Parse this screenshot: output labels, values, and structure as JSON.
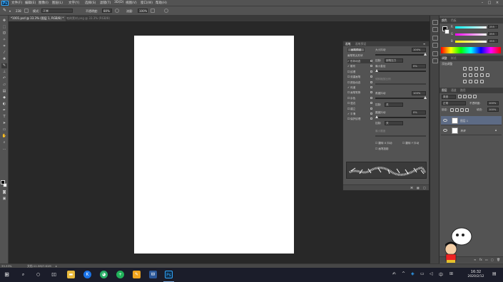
{
  "app": {
    "logo": "Ps"
  },
  "menu": [
    "文件(F)",
    "编辑(E)",
    "图像(I)",
    "图层(L)",
    "文字(Y)",
    "选择(S)",
    "滤镜(T)",
    "3D(D)",
    "视图(V)",
    "窗口(W)",
    "帮助(H)"
  ],
  "options": {
    "brush_size": "238",
    "mode_label": "模式:",
    "mode_value": "正常",
    "opacity_label": "不透明度:",
    "opacity_value": "80%",
    "flow_label": "流量:",
    "flow_value": "100%"
  },
  "tabs": [
    {
      "label": "*1001.psd @ 33.3% (图层 1, RGB/8) *",
      "active": true
    },
    {
      "label": "笔刷素材.png @ 33.3% (RGB/8)",
      "active": false
    }
  ],
  "brush_panel": {
    "tabs": [
      "画笔",
      "画笔预设"
    ],
    "preset_button": "画笔预设",
    "tip_shape_title": "画笔笔尖形状",
    "items": [
      {
        "label": "形状动态",
        "checked": true
      },
      {
        "label": "散布",
        "checked": true
      },
      {
        "label": "纹理",
        "checked": false
      },
      {
        "label": "双重画笔",
        "checked": false
      },
      {
        "label": "颜色动态",
        "checked": false
      },
      {
        "label": "传递",
        "checked": true
      },
      {
        "label": "画笔笔势",
        "checked": false
      },
      {
        "label": "杂色",
        "checked": false
      },
      {
        "label": "湿边",
        "checked": false
      },
      {
        "label": "建立",
        "checked": false
      },
      {
        "label": "平滑",
        "checked": true
      },
      {
        "label": "保护纹理",
        "checked": false
      }
    ],
    "size_jitter_label": "大小抖动",
    "size_jitter_value": "100%",
    "control_label": "控制:",
    "control_value": "钢笔压力",
    "min_diameter_label": "最小直径",
    "min_diameter_value": "0%",
    "tilt_scale_label": "倾斜缩放比例",
    "angle_jitter_label": "角度抖动",
    "angle_jitter_value": "100%",
    "control2_value": "关",
    "roundness_jitter_label": "圆度抖动",
    "roundness_jitter_value": "0%",
    "control3_value": "关",
    "min_roundness_label": "最小圆度",
    "flip_x_label": "翻转 X 抖动",
    "flip_y_label": "翻转 Y 抖动",
    "projection_label": "画笔投影"
  },
  "color_panel": {
    "tabs": [
      "颜色",
      "色板"
    ],
    "channels": [
      {
        "label": "R",
        "value": "255"
      },
      {
        "label": "G",
        "value": "255"
      },
      {
        "label": "B",
        "value": "255"
      }
    ]
  },
  "adjust_panel": {
    "tabs": [
      "调整",
      "样式"
    ],
    "add_label": "添加调整"
  },
  "layers_panel": {
    "tabs": [
      "图层",
      "通道",
      "路径"
    ],
    "kind": "类型",
    "blend_mode": "正常",
    "opacity_label": "不透明度:",
    "opacity_value": "100%",
    "lock_label": "锁定:",
    "fill_label": "填充:",
    "fill_value": "100%",
    "layers": [
      {
        "name": "图层 1",
        "selected": true
      },
      {
        "name": "背景",
        "selected": false
      }
    ]
  },
  "status": {
    "zoom": "33.33%",
    "doc_info": "文档:11.5M/7.61M"
  },
  "taskbar": {
    "time": "16:32",
    "date": "2020/2/12"
  },
  "colors": {
    "ui_bg": "#535353",
    "workspace": "#282828",
    "accent_blue": "#31a8ff",
    "taskbar": "#1b1d2a"
  }
}
